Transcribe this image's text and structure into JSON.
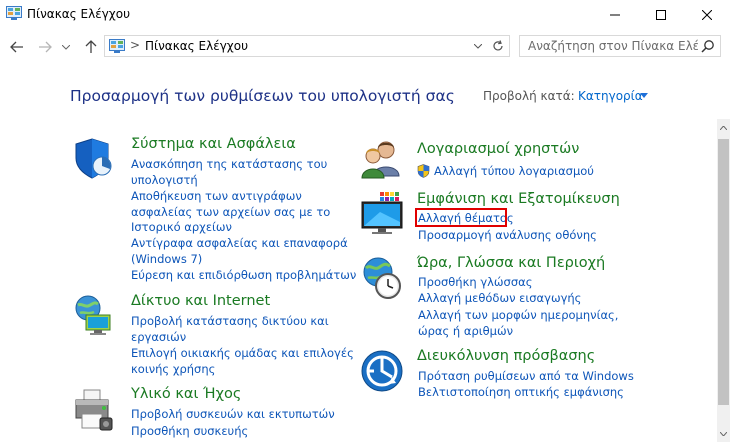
{
  "window": {
    "title": "Πίνακας Ελέγχου"
  },
  "address": {
    "separator": ">",
    "path": "Πίνακας Ελέγχου"
  },
  "search": {
    "placeholder": "Αναζήτηση στον Πίνακα Ελέγ..."
  },
  "header": {
    "heading": "Προσαρμογή των ρυθμίσεων του υπολογιστή σας",
    "view_by_label": "Προβολή κατά:",
    "view_by_value": "Κατηγορία"
  },
  "left": [
    {
      "title": "Σύστημα και Ασφάλεια",
      "links": [
        "Ανασκόπηση της κατάστασης του",
        "υπολογιστή",
        "Αποθήκευση των αντιγράφων",
        "ασφαλείας των αρχείων σας με το",
        "Ιστορικό αρχείων",
        "Αντίγραφα ασφαλείας και επαναφορά",
        "(Windows 7)",
        "Εύρεση και επιδιόρθωση προβλημάτων"
      ]
    },
    {
      "title": "Δίκτυο και Internet",
      "links": [
        "Προβολή κατάστασης δικτύου και",
        "εργασιών",
        "Επιλογή οικιακής ομάδας και επιλογές",
        "κοινής χρήσης"
      ]
    },
    {
      "title": "Υλικό και Ήχος",
      "links": [
        "Προβολή συσκευών και εκτυπωτών",
        "Προσθήκη συσκευής"
      ]
    }
  ],
  "right": [
    {
      "title": "Λογαριασμοί χρηστών",
      "links": [
        "Αλλαγή τύπου λογαριασμού"
      ]
    },
    {
      "title": "Εμφάνιση και Εξατομίκευση",
      "links": [
        "Αλλαγή θέματος",
        "Προσαρμογή ανάλυσης οθόνης"
      ]
    },
    {
      "title": "Ώρα, Γλώσσα και Περιοχή",
      "links": [
        "Προσθήκη γλώσσας",
        "Αλλαγή μεθόδων εισαγωγής",
        "Αλλαγή των μορφών ημερομηνίας,",
        "ώρας ή αριθμών"
      ]
    },
    {
      "title": "Διευκόλυνση πρόσβασης",
      "links": [
        "Πρόταση ρυθμίσεων από τα Windows",
        "Βελτιστοποίηση οπτικής εμφάνισης"
      ]
    }
  ],
  "colors": {
    "category_title": "#1a7a22",
    "link": "#0d55b8",
    "heading": "#1e3287",
    "highlight": "#e00000"
  }
}
